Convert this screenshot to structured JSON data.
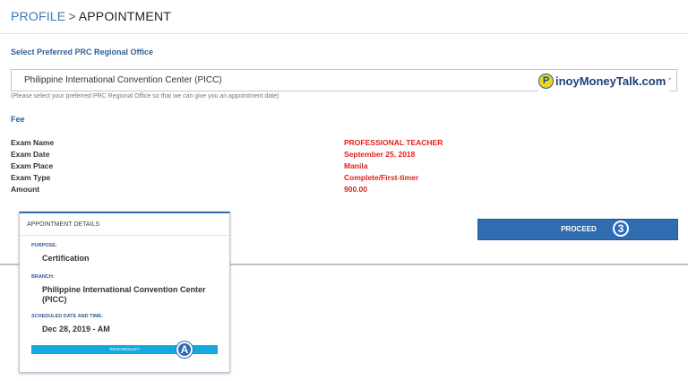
{
  "breadcrumb": {
    "parent": "PROFILE",
    "separator": ">",
    "current": "APPOINTMENT"
  },
  "office": {
    "section_label": "Select Preferred PRC Regional Office",
    "selected": "Philippine International Convention Center (PICC)",
    "hint": "(Please select your preferred PRC Regional Office so that we can give you an appointment date)"
  },
  "watermark": {
    "letter": "P",
    "text": "inoyMoneyTalk.com"
  },
  "fee": {
    "section_label": "Fee",
    "rows": [
      {
        "key": "Exam Name",
        "value": "PROFESSIONAL TEACHER"
      },
      {
        "key": "Exam Date",
        "value": "September 25, 2018"
      },
      {
        "key": "Exam Place",
        "value": "Manila"
      },
      {
        "key": "Exam Type",
        "value": "Complete/First-timer"
      },
      {
        "key": "Amount",
        "value": "900.00"
      }
    ]
  },
  "proceed": {
    "label": "PROCEED",
    "step": "3"
  },
  "appointment": {
    "title": "APPOINTMENT DETAILS",
    "purpose_label": "PURPOSE:",
    "purpose": "Certification",
    "branch_label": "BRANCH:",
    "branch": "Philippine International Convention Center (PICC)",
    "schedule_label": "SCHEDULED DATE AND TIME:",
    "schedule": "Dec 28, 2019 - AM",
    "reschedule_label": "RESCHEDULE?",
    "step": "A"
  },
  "colors": {
    "primary": "#2f6db0",
    "link": "#3a7ab8",
    "alert": "#e0201d",
    "accent": "#14a8e0"
  }
}
